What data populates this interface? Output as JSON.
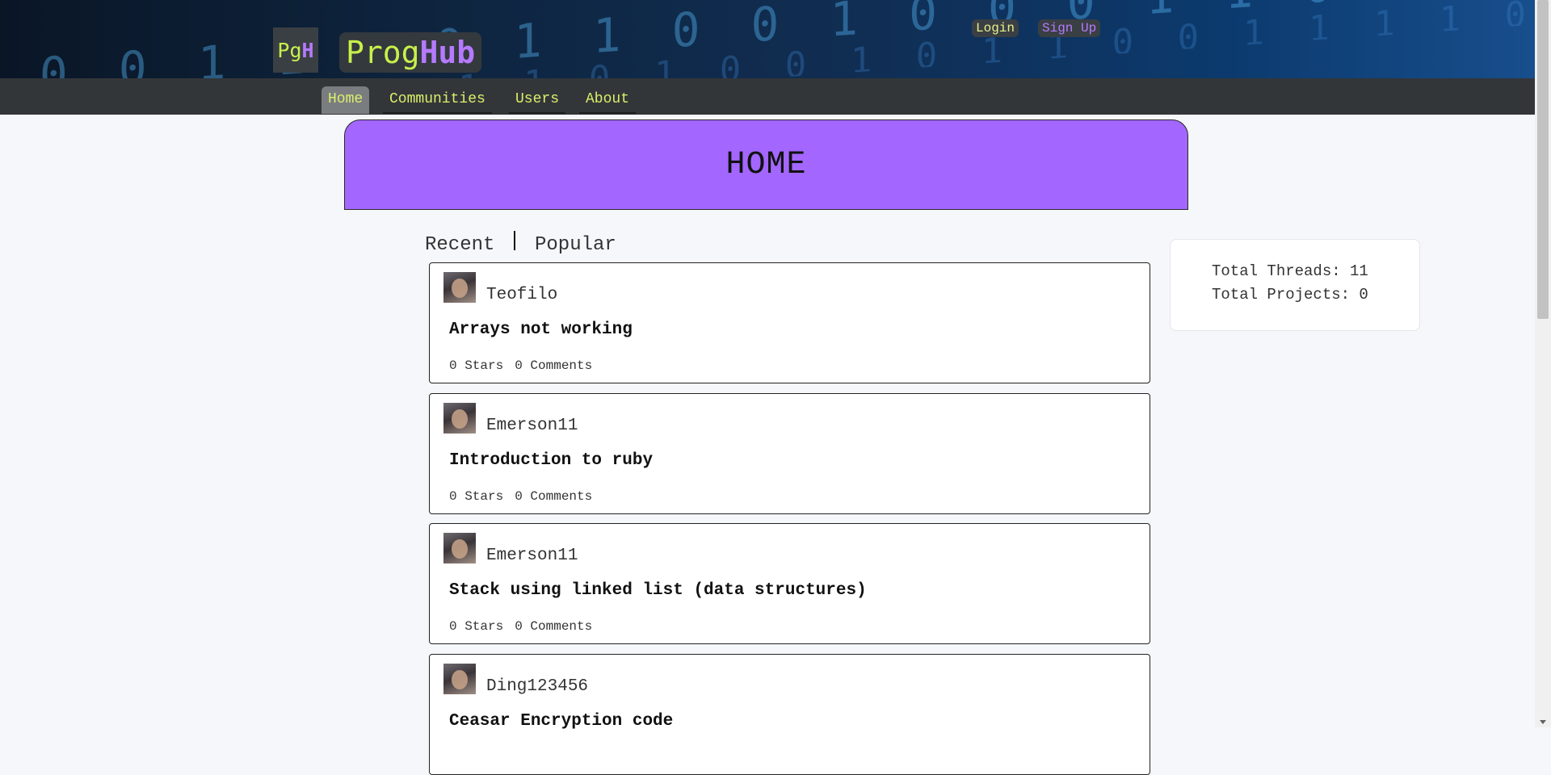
{
  "brand": {
    "logo_pg": "Pg",
    "logo_h": "H",
    "name_prog": "Prog",
    "name_hub": "Hub",
    "colors": {
      "lime": "#c8f04a",
      "purple": "#b57aff"
    }
  },
  "auth": {
    "login": "Login",
    "signup": "Sign Up"
  },
  "nav": {
    "home": "Home",
    "communities": "Communities",
    "users": "Users",
    "about": "About"
  },
  "page": {
    "title": "HOME",
    "header_color": "#a366ff"
  },
  "tabs": {
    "recent": "Recent",
    "popular": "Popular"
  },
  "threads": [
    {
      "user": "Teofilo",
      "title": "Arrays not working",
      "stars": "0 Stars",
      "comments": "0 Comments"
    },
    {
      "user": "Emerson11",
      "title": "Introduction to ruby",
      "stars": "0 Stars",
      "comments": "0 Comments"
    },
    {
      "user": "Emerson11",
      "title": "Stack using linked list (data structures)",
      "stars": "0 Stars",
      "comments": "0 Comments"
    },
    {
      "user": "Ding123456",
      "title": "Ceasar Encryption code",
      "stars": "",
      "comments": ""
    }
  ],
  "stats": {
    "threads": "Total Threads: 11",
    "projects": "Total Projects: 0"
  }
}
